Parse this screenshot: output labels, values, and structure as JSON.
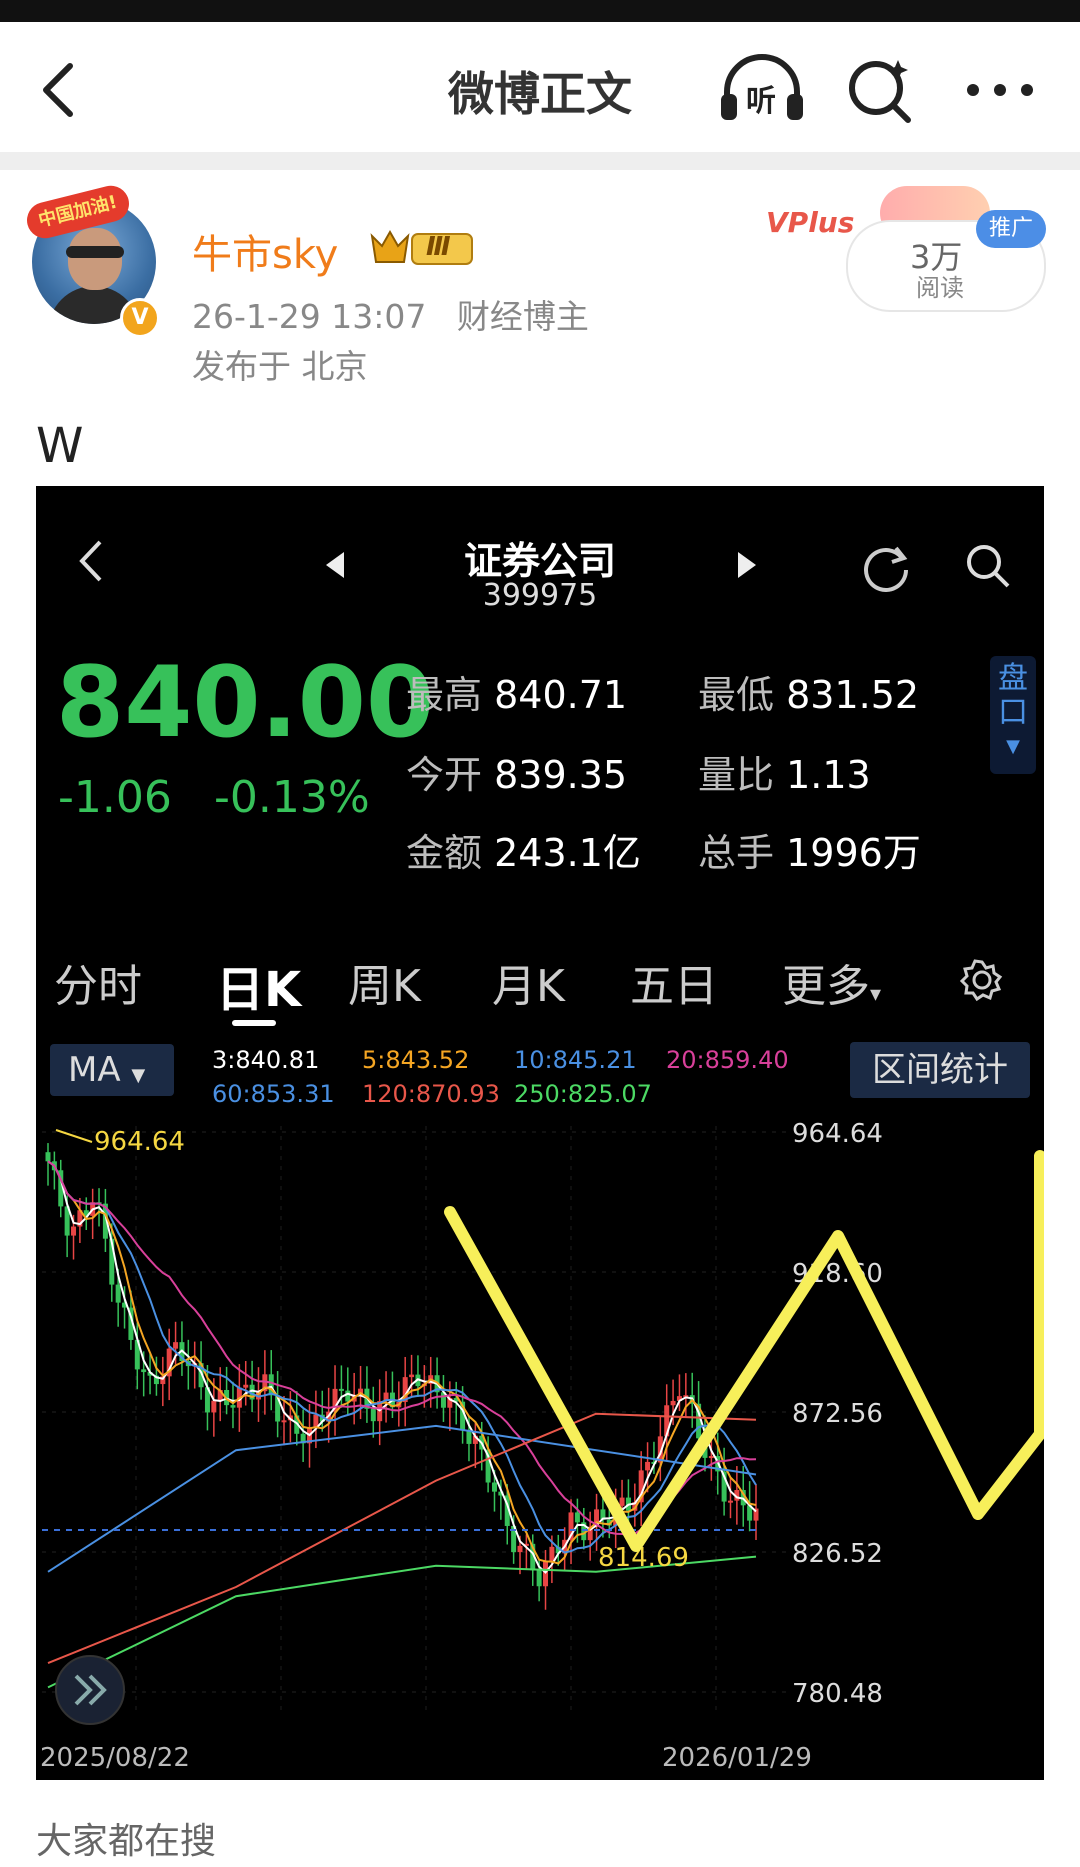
{
  "nav": {
    "title": "微博正文",
    "listen_label": "听"
  },
  "post": {
    "username": "牛市sky",
    "badge_level": "Ⅲ",
    "flag_text": "中国加油!",
    "verify_symbol": "V",
    "timestamp": "26-1-29 13:07",
    "role": "财经博主",
    "location": "发布于 北京",
    "text": "W"
  },
  "ad": {
    "brand": "VPlus",
    "reads": "3万",
    "reads_label": "阅读",
    "tag": "推广"
  },
  "stock": {
    "name": "证券公司",
    "code": "399975",
    "price": "840.00",
    "change": "-1.06",
    "change_pct": "-0.13%",
    "stats": [
      {
        "label": "最高",
        "value": "840.71"
      },
      {
        "label": "最低",
        "value": "831.52"
      },
      {
        "label": "今开",
        "value": "839.35"
      },
      {
        "label": "量比",
        "value": "1.13"
      },
      {
        "label": "金额",
        "value": "243.1亿"
      },
      {
        "label": "总手",
        "value": "1996万"
      }
    ],
    "pankou": "盘口",
    "tabs": [
      "分时",
      "日K",
      "周K",
      "月K",
      "五日",
      "更多"
    ],
    "active_tab": "日K",
    "indicator": "MA",
    "range_stats_button": "区间统计",
    "ma_values": [
      {
        "label": "3:840.81",
        "color": "#ffffff"
      },
      {
        "label": "5:843.52",
        "color": "#f5a623"
      },
      {
        "label": "10:845.21",
        "color": "#4a90e2"
      },
      {
        "label": "20:859.40",
        "color": "#d8409a"
      },
      {
        "label": "60:853.31",
        "color": "#4a90e2"
      },
      {
        "label": "120:870.93",
        "color": "#e8574a"
      },
      {
        "label": "250:825.07",
        "color": "#4cd964"
      }
    ]
  },
  "chart_data": {
    "type": "candlestick",
    "y_ticks": [
      "964.64",
      "918.60",
      "872.56",
      "826.52",
      "780.48"
    ],
    "ylim": [
      780.48,
      964.64
    ],
    "x_start_label": "2025/08/22",
    "x_end_label": "2026/01/29",
    "max_annotation": "964.64",
    "min_annotation": "814.69",
    "last_close": 840.0,
    "overlay": "W"
  },
  "footer": {
    "search_hint": "大家都在搜"
  }
}
